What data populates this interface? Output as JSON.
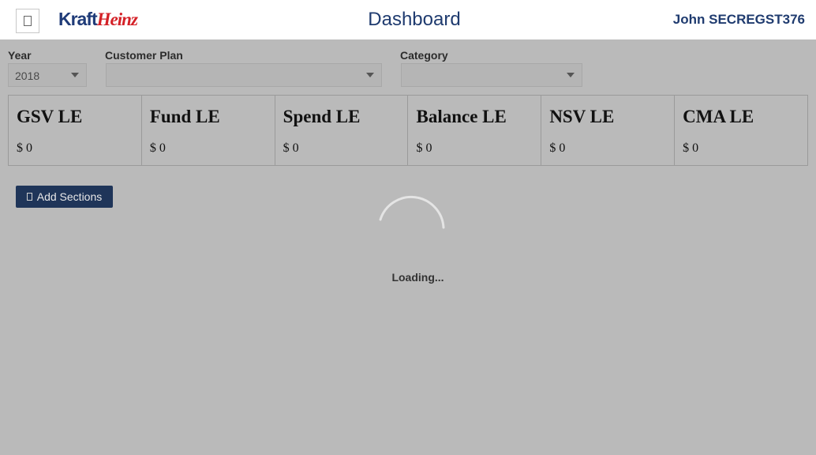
{
  "header": {
    "logo_part1": "Kraft",
    "logo_part2": "Heinz",
    "title": "Dashboard",
    "user": "John SECREGST376"
  },
  "filters": {
    "year": {
      "label": "Year",
      "value": "2018"
    },
    "customer_plan": {
      "label": "Customer Plan",
      "value": ""
    },
    "category": {
      "label": "Category",
      "value": ""
    }
  },
  "kpis": [
    {
      "title": "GSV LE",
      "value": "$ 0"
    },
    {
      "title": "Fund LE",
      "value": "$ 0"
    },
    {
      "title": "Spend LE",
      "value": "$ 0"
    },
    {
      "title": "Balance LE",
      "value": "$ 0"
    },
    {
      "title": "NSV LE",
      "value": "$ 0"
    },
    {
      "title": "CMA LE",
      "value": "$ 0"
    }
  ],
  "actions": {
    "add_sections": "Add Sections"
  },
  "loading": {
    "text": "Loading..."
  },
  "colors": {
    "brand_navy": "#1f3b6f",
    "brand_red": "#d42127",
    "overlay_gray": "#bababa",
    "button_navy": "#1f3559"
  },
  "icons": {
    "menu": "menu-icon",
    "add": "add-icon",
    "dropdown": "chevron-down-icon",
    "spinner": "loading-spinner-icon"
  }
}
